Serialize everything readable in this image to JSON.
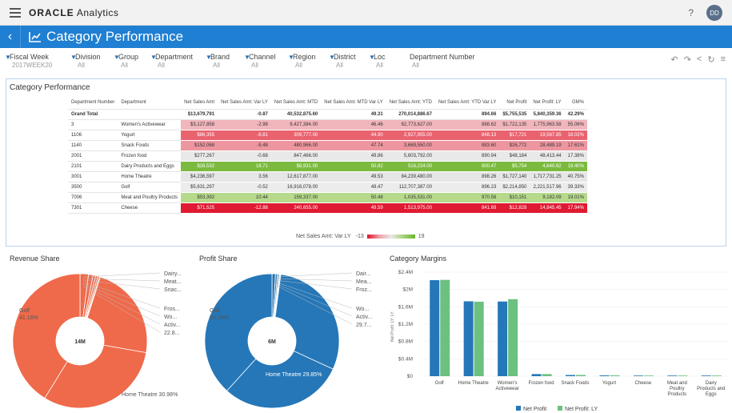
{
  "app": {
    "brand_strong": "ORACLE",
    "brand_name": "Analytics",
    "help": "?",
    "avatar": "DD"
  },
  "title": "Category Performance",
  "filters": [
    {
      "label": "Fiscal Week",
      "value": "2017WEEK20"
    },
    {
      "label": "Division",
      "value": "All"
    },
    {
      "label": "Group",
      "value": "All"
    },
    {
      "label": "Department",
      "value": "All"
    },
    {
      "label": "Brand",
      "value": "All"
    },
    {
      "label": "Channel",
      "value": "All"
    },
    {
      "label": "Region",
      "value": "All"
    },
    {
      "label": "District",
      "value": "All"
    },
    {
      "label": "Loc",
      "value": "All"
    },
    {
      "label": "Department Number",
      "value": "All"
    }
  ],
  "table": {
    "title": "Category Performance",
    "headers": [
      "Department Number",
      "Department",
      "Net Sales Amt",
      "Net Sales Amt: Var LY",
      "Net Sales Amt: MTD",
      "Net Sales Amt: MTD Var LY",
      "Net Sales Amt: YTD",
      "Net Sales Amt: YTD Var LY",
      "Net Profit",
      "Net Profit: LY",
      "GM%"
    ],
    "grand_total": [
      "Grand Total",
      "",
      "$13,679,791",
      "-0.87",
      "40,532,875.60",
      "49.31",
      "270,014,886.67",
      "894.66",
      "$5,755,535",
      "5,840,359.36",
      "42.29%"
    ],
    "rows": [
      {
        "cells": [
          "3",
          "Women's Activewear",
          "$3,127,858",
          "-2.98",
          "9,427,384.00",
          "46.46",
          "62,773,627.00",
          "888.62",
          "$1,722,135",
          "1,775,963.58",
          "55.06%"
        ],
        "color": "#f1b5bc"
      },
      {
        "cells": [
          "1106",
          "Yogurt",
          "$86,355",
          "-8.81",
          "309,777.00",
          "44.90",
          "2,927,955.00",
          "848.13",
          "$17,721",
          "19,567.85",
          "18.02%"
        ],
        "color": "#e9636f"
      },
      {
        "cells": [
          "1140",
          "Snack Foods",
          "$152,068",
          "-5.48",
          "480,966.00",
          "47.74",
          "3,669,550.00",
          "883.60",
          "$26,772",
          "28,489.19",
          "17.61%"
        ],
        "color": "#ee96a0"
      },
      {
        "cells": [
          "2001",
          "Frozen food",
          "$277,267",
          "-0.68",
          "847,466.00",
          "49.86",
          "5,603,792.00",
          "890.94",
          "$48,184",
          "48,413.44",
          "17.38%"
        ],
        "color": "#e9e9e9"
      },
      {
        "cells": [
          "2101",
          "Dairy Products and Eggs",
          "$28,532",
          "18.71",
          "$8,931.00",
          "50.82",
          "516,224.00",
          "900.47",
          "$5,754",
          "4,640.62",
          "19.40%"
        ],
        "color": "#7bba3e"
      },
      {
        "cells": [
          "3001",
          "Home Theatre",
          "$4,236,597",
          "3.56",
          "12,617,877.00",
          "49.53",
          "84,239,480.00",
          "898.26",
          "$1,727,140",
          "1,717,731.25",
          "40.75%"
        ],
        "color": "#e6e6e6"
      },
      {
        "cells": [
          "3500",
          "Golf",
          "$5,631,297",
          "-0.52",
          "16,918,078.00",
          "49.47",
          "112,707,387.00",
          "896.23",
          "$2,214,850",
          "2,221,517.96",
          "39.33%"
        ],
        "color": "#ececec"
      },
      {
        "cells": [
          "7006",
          "Meat and Poultry Products",
          "$53,392",
          "10.44",
          "159,337.00",
          "50.48",
          "1,035,531.00",
          "970.58",
          "$10,151",
          "9,182.09",
          "19.01%"
        ],
        "color": "#b6d98c"
      },
      {
        "cells": [
          "7301",
          "Cheese",
          "$71,525",
          "-12.88",
          "240,655.00",
          "49.59",
          "1,513,975.00",
          "841.69",
          "$12,828",
          "14,845.45",
          "17.94%"
        ],
        "color": "#df1a32"
      }
    ],
    "legend": {
      "label": "Net Sales Amt: Var LY",
      "min": "-13",
      "max": "19"
    }
  },
  "revenue_share": {
    "title": "Revenue Share",
    "center": "14M",
    "color": "#ef6a4a",
    "labels_right": [
      "Dairy...",
      "Meat...",
      "Snac...",
      "Fros...",
      "Wo...",
      "Activ...",
      "22.8..."
    ],
    "label_left": [
      "Golf",
      "41.16%"
    ],
    "label_bottom": "Home Theatre 30.98%",
    "slices": [
      {
        "name": "Golf",
        "value": 41.16
      },
      {
        "name": "Home Theatre",
        "value": 30.98
      },
      {
        "name": "Women's Activewear",
        "value": 22.87
      },
      {
        "name": "Frozen food",
        "value": 2.03
      },
      {
        "name": "Snack Foods",
        "value": 1.11
      },
      {
        "name": "Yogurt",
        "value": 0.63
      },
      {
        "name": "Cheese",
        "value": 0.52
      },
      {
        "name": "Meat and Poultry Products",
        "value": 0.39
      },
      {
        "name": "Dairy Products and Eggs",
        "value": 0.21
      }
    ]
  },
  "profit_share": {
    "title": "Profit Share",
    "center": "6M",
    "color": "#2577b8",
    "labels_right": [
      "Dair...",
      "Mea...",
      "Froz...",
      "Wo...",
      "Activ...",
      "29.7..."
    ],
    "label_left": [
      "Golf",
      "38.28%"
    ],
    "label_bottom": "Home Theatre 29.85%",
    "slices": [
      {
        "name": "Golf",
        "value": 38.28
      },
      {
        "name": "Home Theatre",
        "value": 29.85
      },
      {
        "name": "Women's Activewear",
        "value": 29.76
      },
      {
        "name": "Frozen food",
        "value": 0.83
      },
      {
        "name": "Snack Foods",
        "value": 0.46
      },
      {
        "name": "Yogurt",
        "value": 0.31
      },
      {
        "name": "Cheese",
        "value": 0.22
      },
      {
        "name": "Meat and Poultry Products",
        "value": 0.18
      },
      {
        "name": "Dairy Products and Eggs",
        "value": 0.11
      }
    ]
  },
  "chart_data": {
    "type": "bar",
    "title": "Category Margins",
    "ylabel": "Net Profit: LY: LY",
    "ylim": [
      0,
      2400000
    ],
    "yticks": [
      "$0",
      "$0.4M",
      "$0.8M",
      "$1.2M",
      "$1.6M",
      "$2M",
      "$2.4M"
    ],
    "categories": [
      "Golf",
      "Home Theatre",
      "Women's Activewear",
      "Frozen food",
      "Snack Foods",
      "Yogurt",
      "Cheese",
      "Meat and Poultry Products",
      "Dairy Products and Eggs"
    ],
    "category_labels": [
      [
        "Golf"
      ],
      [
        "Home Theatre"
      ],
      [
        "Women's",
        "Activewear"
      ],
      [
        "Frozen food"
      ],
      [
        "Snack Foods"
      ],
      [
        "Yogurt"
      ],
      [
        "Cheese"
      ],
      [
        "Meat and",
        "Poultry",
        "Products"
      ],
      [
        "Dairy",
        "Products and",
        "Eggs"
      ]
    ],
    "series": [
      {
        "name": "Net Profit",
        "color": "#2577b8",
        "values": [
          2214850,
          1727140,
          1722135,
          48184,
          26772,
          17721,
          12828,
          10151,
          5754
        ]
      },
      {
        "name": "Net Profit: LY",
        "color": "#6cc080",
        "values": [
          2221517.96,
          1717731.25,
          1775963.58,
          48413.44,
          28489.19,
          19567.85,
          14845.45,
          9182.09,
          4640.62
        ]
      }
    ],
    "legend_position": "bottom"
  }
}
